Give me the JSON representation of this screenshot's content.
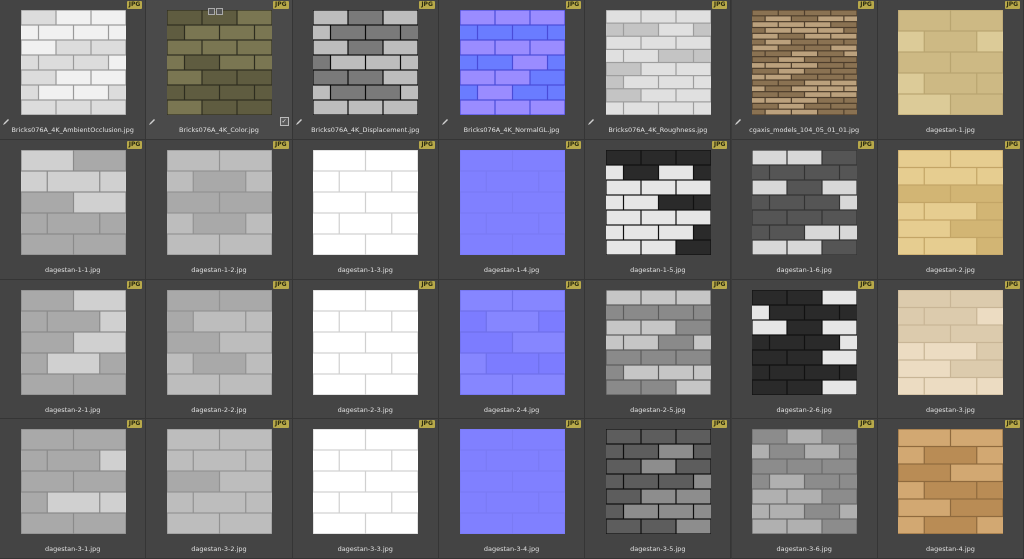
{
  "browser": {
    "badge_label": "JPG",
    "items": [
      {
        "name": "Bricks076A_4K_AmbientOcclusion.jpg",
        "kind": "ao",
        "pencil": true
      },
      {
        "name": "Bricks076A_4K_Color.jpg",
        "kind": "color",
        "pencil": true,
        "check": true,
        "top_icons": true
      },
      {
        "name": "Bricks076A_4K_Displacement.jpg",
        "kind": "disp",
        "pencil": true
      },
      {
        "name": "Bricks076A_4K_NormalGL.jpg",
        "kind": "normalbrick",
        "pencil": true
      },
      {
        "name": "Bricks076A_4K_Roughness.jpg",
        "kind": "rough",
        "pencil": true
      },
      {
        "name": "cgaxis_models_104_05_01_01.jpg",
        "kind": "stone",
        "pencil": true
      },
      {
        "name": "dagestan-1.jpg",
        "kind": "beige"
      },
      {
        "name": "dagestan-1-1.jpg",
        "kind": "greyrough"
      },
      {
        "name": "dagestan-1-2.jpg",
        "kind": "grey"
      },
      {
        "name": "dagestan-1-3.jpg",
        "kind": "white"
      },
      {
        "name": "dagestan-1-4.jpg",
        "kind": "flatnormal"
      },
      {
        "name": "dagestan-1-5.jpg",
        "kind": "bwspeckle"
      },
      {
        "name": "dagestan-1-6.jpg",
        "kind": "bwspeckle2"
      },
      {
        "name": "dagestan-2.jpg",
        "kind": "beige2"
      },
      {
        "name": "dagestan-2-1.jpg",
        "kind": "greyrough"
      },
      {
        "name": "dagestan-2-2.jpg",
        "kind": "grey"
      },
      {
        "name": "dagestan-2-3.jpg",
        "kind": "white"
      },
      {
        "name": "dagestan-2-4.jpg",
        "kind": "normal2"
      },
      {
        "name": "dagestan-2-5.jpg",
        "kind": "greyrough2"
      },
      {
        "name": "dagestan-2-6.jpg",
        "kind": "bwspeckle"
      },
      {
        "name": "dagestan-3.jpg",
        "kind": "cream"
      },
      {
        "name": "dagestan-3-1.jpg",
        "kind": "greyrough"
      },
      {
        "name": "dagestan-3-2.jpg",
        "kind": "grey"
      },
      {
        "name": "dagestan-3-3.jpg",
        "kind": "white"
      },
      {
        "name": "dagestan-3-4.jpg",
        "kind": "flatnormal"
      },
      {
        "name": "dagestan-3-5.jpg",
        "kind": "darkbrick"
      },
      {
        "name": "dagestan-3-6.jpg",
        "kind": "midgrey"
      },
      {
        "name": "dagestan-4.jpg",
        "kind": "tan"
      }
    ]
  },
  "colors": {
    "badge": "#b8a94a",
    "panel": "#444444",
    "text": "#e2e2e2"
  }
}
